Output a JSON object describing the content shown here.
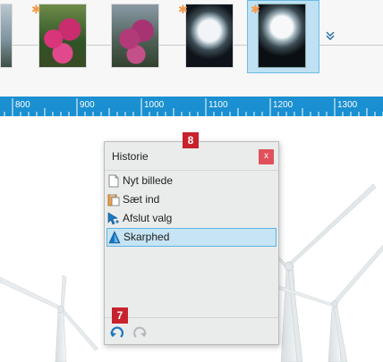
{
  "filmstrip": {
    "thumbnails": [
      {
        "name": "landscape-partial",
        "modified": false
      },
      {
        "name": "pink-flowers",
        "modified": true
      },
      {
        "name": "pink-flowers-edit",
        "modified": false
      },
      {
        "name": "lens-dark",
        "modified": true
      },
      {
        "name": "lens-dark-selected",
        "modified": true,
        "selected": true
      }
    ],
    "modified_marker": "✱",
    "more_icon": "chevron-down-icon",
    "selected_color": "#bfe1f3"
  },
  "ruler": {
    "labels": [
      "800",
      "900",
      "1000",
      "1100",
      "1200",
      "1300"
    ],
    "color": "#1a8fd1"
  },
  "history_panel": {
    "title": "Historie",
    "close_label": "x",
    "items": [
      {
        "label": "Nyt billede",
        "icon": "new-image-icon",
        "active": false
      },
      {
        "label": "Sæt ind",
        "icon": "paste-icon",
        "active": false
      },
      {
        "label": "Afslut valg",
        "icon": "end-selection-icon",
        "active": false
      },
      {
        "label": "Skarphed",
        "icon": "sharpen-icon",
        "active": true
      }
    ],
    "undo_icon": "undo-icon",
    "redo_icon": "redo-icon",
    "accent": "#5cb4e2"
  },
  "callouts": {
    "panel_marker": "8",
    "undo_marker": "7",
    "color": "#c8222d"
  }
}
